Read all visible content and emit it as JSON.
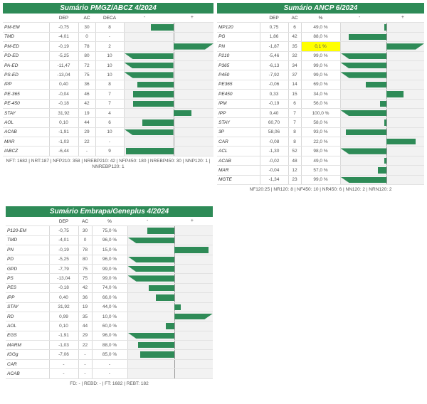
{
  "pmgz": {
    "title": "Sumário PMGZ/ABCZ 4/2024",
    "headers": [
      "",
      "DEP",
      "AC",
      "DECA",
      "-",
      "+"
    ],
    "scale": 32,
    "rows": [
      {
        "name": "PM-EM",
        "dep": "-0,75",
        "ac": "30",
        "c": "8",
        "v": -0.75
      },
      {
        "name": "TMD",
        "dep": "-4,01",
        "ac": "0",
        "c": "-",
        "v": null
      },
      {
        "name": "PM-ED",
        "dep": "-0,19",
        "ac": "78",
        "c": "2",
        "v": -0.19
      },
      {
        "name": "PD-ED",
        "dep": "-5,25",
        "ac": "80",
        "c": "10",
        "v": -5.25
      },
      {
        "name": "PA-ED",
        "dep": "-11,47",
        "ac": "72",
        "c": "10",
        "v": -11.47
      },
      {
        "name": "PS-ED",
        "dep": "-13,04",
        "ac": "75",
        "c": "10",
        "v": -13.04
      },
      {
        "name": "IPP",
        "dep": "0,40",
        "ac": "36",
        "c": "8",
        "v": 0.4
      },
      {
        "name": "PE-365",
        "dep": "-0,04",
        "ac": "46",
        "c": "7",
        "v": -0.04
      },
      {
        "name": "PE-450",
        "dep": "-0,18",
        "ac": "42",
        "c": "7",
        "v": -0.18
      },
      {
        "name": "STAY",
        "dep": "31,92",
        "ac": "19",
        "c": "4",
        "v": 31.92
      },
      {
        "name": "AOL",
        "dep": "0,10",
        "ac": "44",
        "c": "6",
        "v": 0.1
      },
      {
        "name": "ACAB",
        "dep": "-1,91",
        "ac": "29",
        "c": "10",
        "v": -1.91
      },
      {
        "name": "MAR",
        "dep": "-1,03",
        "ac": "22",
        "c": "-",
        "v": null
      },
      {
        "name": "IABCZ",
        "dep": "-6,44",
        "ac": "-",
        "c": "9",
        "v": -6.44
      }
    ],
    "bars": [
      {
        "l": 0.3,
        "r": 0.55
      },
      {
        "l": 0,
        "r": 0
      },
      {
        "l": 0.55,
        "r": 1
      },
      {
        "l": 0,
        "r": 0.55
      },
      {
        "l": 0,
        "r": 0.55
      },
      {
        "l": 0,
        "r": 0.55
      },
      {
        "l": 0.15,
        "r": 0.55
      },
      {
        "l": 0.1,
        "r": 0.55
      },
      {
        "l": 0.1,
        "r": 0.55
      },
      {
        "l": 0.55,
        "r": 0.75
      },
      {
        "l": 0.2,
        "r": 0.55
      },
      {
        "l": 0,
        "r": 0.55
      },
      {
        "l": 0,
        "r": 0
      },
      {
        "l": 0.02,
        "r": 0.55
      }
    ],
    "footer": "NFT: 1682 | NRT:187 | NFP210: 358 | NREBP210: 42 | NFP450: 180 | NREBP450: 30 | NNP120: 1 | NNREBP120: 1"
  },
  "ancp": {
    "title": "Sumário ANCP 6/2024",
    "headers": [
      "",
      "DEP",
      "AC",
      "%",
      "-",
      "+"
    ],
    "rows": [
      {
        "name": "MP120",
        "dep": "0,75",
        "ac": "6",
        "c": "49,0 %"
      },
      {
        "name": "PG",
        "dep": "1,86",
        "ac": "42",
        "c": "88,0 %"
      },
      {
        "name": "PN",
        "dep": "-1,87",
        "ac": "35",
        "c": "0,1 %",
        "hl": true
      },
      {
        "name": "P210",
        "dep": "-5,46",
        "ac": "32",
        "c": "99,0 %"
      },
      {
        "name": "P365",
        "dep": "-6,13",
        "ac": "34",
        "c": "99,0 %"
      },
      {
        "name": "P450",
        "dep": "-7,92",
        "ac": "37",
        "c": "99,0 %"
      },
      {
        "name": "PE365",
        "dep": "-0,06",
        "ac": "14",
        "c": "69,0 %"
      },
      {
        "name": "PE450",
        "dep": "0,33",
        "ac": "15",
        "c": "34,0 %"
      },
      {
        "name": "IPM",
        "dep": "-0,19",
        "ac": "6",
        "c": "56,0 %"
      },
      {
        "name": "IPP",
        "dep": "0,40",
        "ac": "7",
        "c": "100,0 %"
      },
      {
        "name": "STAY",
        "dep": "60,70",
        "ac": "7",
        "c": "58,0 %"
      },
      {
        "name": "3P",
        "dep": "58,06",
        "ac": "8",
        "c": "93,0 %"
      },
      {
        "name": "CAR",
        "dep": "-0,08",
        "ac": "8",
        "c": "22,0 %"
      },
      {
        "name": "ACL",
        "dep": "-1,30",
        "ac": "52",
        "c": "98,0 %"
      },
      {
        "name": "ACAB",
        "dep": "-0,02",
        "ac": "48",
        "c": "49,0 %"
      },
      {
        "name": "MAR",
        "dep": "-0,04",
        "ac": "12",
        "c": "57,0 %"
      },
      {
        "name": "MGTE",
        "dep": "-1,34",
        "ac": "23",
        "c": "99,0 %"
      }
    ],
    "bars": [
      {
        "l": 0.52,
        "r": 0.55
      },
      {
        "l": 0.1,
        "r": 0.55
      },
      {
        "l": 0.55,
        "r": 1
      },
      {
        "l": 0,
        "r": 0.55
      },
      {
        "l": 0,
        "r": 0.55
      },
      {
        "l": 0,
        "r": 0.55
      },
      {
        "l": 0.3,
        "r": 0.55
      },
      {
        "l": 0.55,
        "r": 0.75
      },
      {
        "l": 0.47,
        "r": 0.55
      },
      {
        "l": 0,
        "r": 0.55
      },
      {
        "l": 0.52,
        "r": 0.55
      },
      {
        "l": 0.06,
        "r": 0.55
      },
      {
        "l": 0.55,
        "r": 0.9
      },
      {
        "l": 0,
        "r": 0.55
      },
      {
        "l": 0.52,
        "r": 0.55
      },
      {
        "l": 0.45,
        "r": 0.55
      },
      {
        "l": 0,
        "r": 0.55
      }
    ],
    "footer": "NF120:25 | NR120: 8 | NF450: 10 | NR450: 6 | NN120: 2 | NRN120: 2"
  },
  "embrapa": {
    "title": "Sumário Embrapa/Geneplus 4/2024",
    "headers": [
      "",
      "DEP",
      "AC",
      "%",
      "-",
      "+"
    ],
    "rows": [
      {
        "name": "P120-EM",
        "dep": "-0,75",
        "ac": "30",
        "c": "75,0 %"
      },
      {
        "name": "TMD",
        "dep": "-4,01",
        "ac": "0",
        "c": "96,0 %"
      },
      {
        "name": "PN",
        "dep": "-0,19",
        "ac": "78",
        "c": "15,0 %"
      },
      {
        "name": "PD",
        "dep": "-5,25",
        "ac": "80",
        "c": "96,0 %"
      },
      {
        "name": "GPD",
        "dep": "-7,79",
        "ac": "75",
        "c": "99,0 %"
      },
      {
        "name": "PS",
        "dep": "-13,04",
        "ac": "75",
        "c": "99,0 %"
      },
      {
        "name": "PES",
        "dep": "-0,18",
        "ac": "42",
        "c": "74,0 %"
      },
      {
        "name": "IPP",
        "dep": "0,40",
        "ac": "36",
        "c": "66,0 %"
      },
      {
        "name": "STAY",
        "dep": "31,92",
        "ac": "19",
        "c": "44,0 %"
      },
      {
        "name": "RD",
        "dep": "0,99",
        "ac": "35",
        "c": "10,0 %"
      },
      {
        "name": "AOL",
        "dep": "0,10",
        "ac": "44",
        "c": "60,0 %"
      },
      {
        "name": "EGS",
        "dep": "-1,91",
        "ac": "29",
        "c": "96,0 %"
      },
      {
        "name": "MARM",
        "dep": "-1,03",
        "ac": "22",
        "c": "88,0 %"
      },
      {
        "name": "IGGg",
        "dep": "-7,06",
        "ac": "-",
        "c": "85,0 %"
      },
      {
        "name": "CAR",
        "dep": "-",
        "ac": "-",
        "c": "-"
      },
      {
        "name": "ACAB",
        "dep": "-",
        "ac": "-",
        "c": "-"
      }
    ],
    "bars": [
      {
        "l": 0.23,
        "r": 0.55
      },
      {
        "l": 0,
        "r": 0.55
      },
      {
        "l": 0.55,
        "r": 0.95
      },
      {
        "l": 0,
        "r": 0.55
      },
      {
        "l": 0,
        "r": 0.55
      },
      {
        "l": 0,
        "r": 0.55
      },
      {
        "l": 0.25,
        "r": 0.55
      },
      {
        "l": 0.33,
        "r": 0.55
      },
      {
        "l": 0.55,
        "r": 0.62
      },
      {
        "l": 0.55,
        "r": 1
      },
      {
        "l": 0.45,
        "r": 0.55
      },
      {
        "l": 0,
        "r": 0.55
      },
      {
        "l": 0.12,
        "r": 0.55
      },
      {
        "l": 0.15,
        "r": 0.55
      },
      {
        "l": 0,
        "r": 0
      },
      {
        "l": 0,
        "r": 0
      }
    ],
    "footer": "FD: - | REBD: - | FT: 1682 | REBT: 182"
  }
}
